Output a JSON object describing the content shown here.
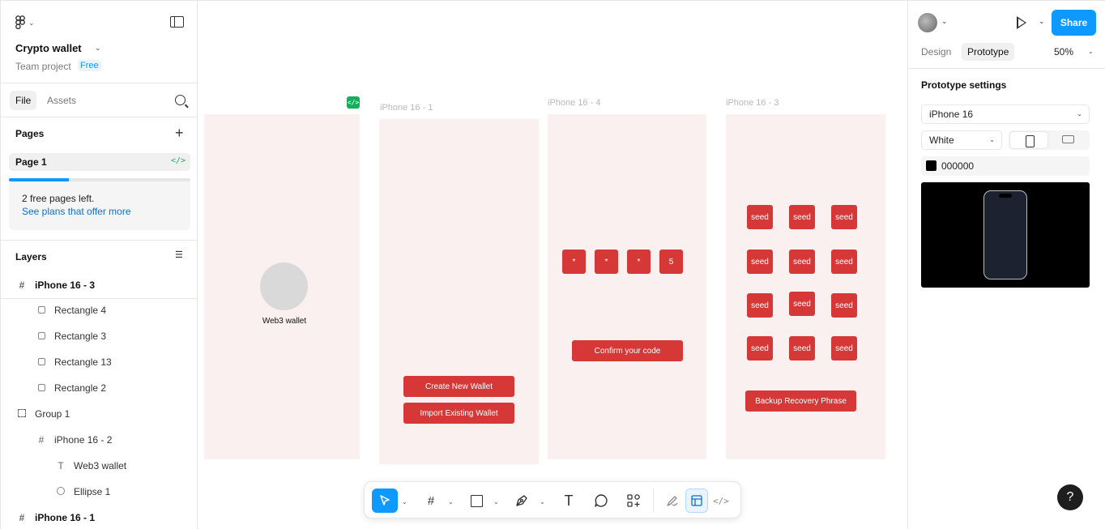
{
  "left_panel": {
    "project_title": "Crypto wallet",
    "team_label": "Team project",
    "plan_badge": "Free",
    "tabs": [
      {
        "label": "File"
      },
      {
        "label": "Assets"
      }
    ],
    "pages_heading": "Pages",
    "current_page": "Page 1",
    "page_code_icon": "</>",
    "free_pages_text": "2 free pages left.",
    "plans_link": "See plans that offer more",
    "pages_progress": 0.33,
    "layers_heading": "Layers",
    "layers": [
      {
        "label": "iPhone 16 - 3",
        "icon": "frame-icon"
      },
      {
        "label": "Rectangle 4",
        "icon": "rectangle-icon"
      },
      {
        "label": "Rectangle 3",
        "icon": "rectangle-icon"
      },
      {
        "label": "Rectangle 13",
        "icon": "rectangle-icon"
      },
      {
        "label": "Rectangle 2",
        "icon": "rectangle-icon"
      },
      {
        "label": "Group 1",
        "icon": "group-icon"
      },
      {
        "label": "iPhone 16 - 2",
        "icon": "frame-icon"
      },
      {
        "label": "Web3 wallet",
        "icon": "text-icon"
      },
      {
        "label": "Ellipse 1",
        "icon": "ellipse-icon"
      },
      {
        "label": "iPhone 16 - 1",
        "icon": "frame-icon"
      }
    ]
  },
  "canvas": {
    "frames": [
      {
        "label": "iPhone 16 - 1"
      },
      {
        "label": "iPhone 16 - 4"
      },
      {
        "label": "iPhone 16 - 3"
      }
    ],
    "frame2": {
      "ellipse_text": "Web3 wallet",
      "code_chip": "</>"
    },
    "frame1": {
      "create_btn": "Create New Wallet",
      "import_btn": "Import Existing Wallet"
    },
    "frame4": {
      "pin_digits": [
        "*",
        "*",
        "*",
        "5"
      ],
      "confirm_btn": "Confirm your code"
    },
    "frame3": {
      "seed_word": "seed",
      "backup_btn": "Backup Recovery Phrase"
    }
  },
  "toolbar": {
    "tools": [
      "move-tool",
      "frame-tool",
      "shape-tool",
      "pen-tool",
      "text-tool",
      "comment-tool",
      "actions-tool",
      "draw-mode",
      "design-mode",
      "dev-mode"
    ],
    "text_glyph": "T"
  },
  "right_panel": {
    "share_label": "Share",
    "tabs": [
      {
        "label": "Design"
      },
      {
        "label": "Prototype"
      }
    ],
    "zoom": "50%",
    "settings_heading": "Prototype settings",
    "device": "iPhone 16",
    "device_color": "White",
    "background_color": "000000",
    "help_label": "?"
  },
  "colors": {
    "accent": "#0d99ff",
    "frame_bg": "#fbf0f0",
    "button_red": "#d63838",
    "dev_green": "#14ae5c"
  }
}
